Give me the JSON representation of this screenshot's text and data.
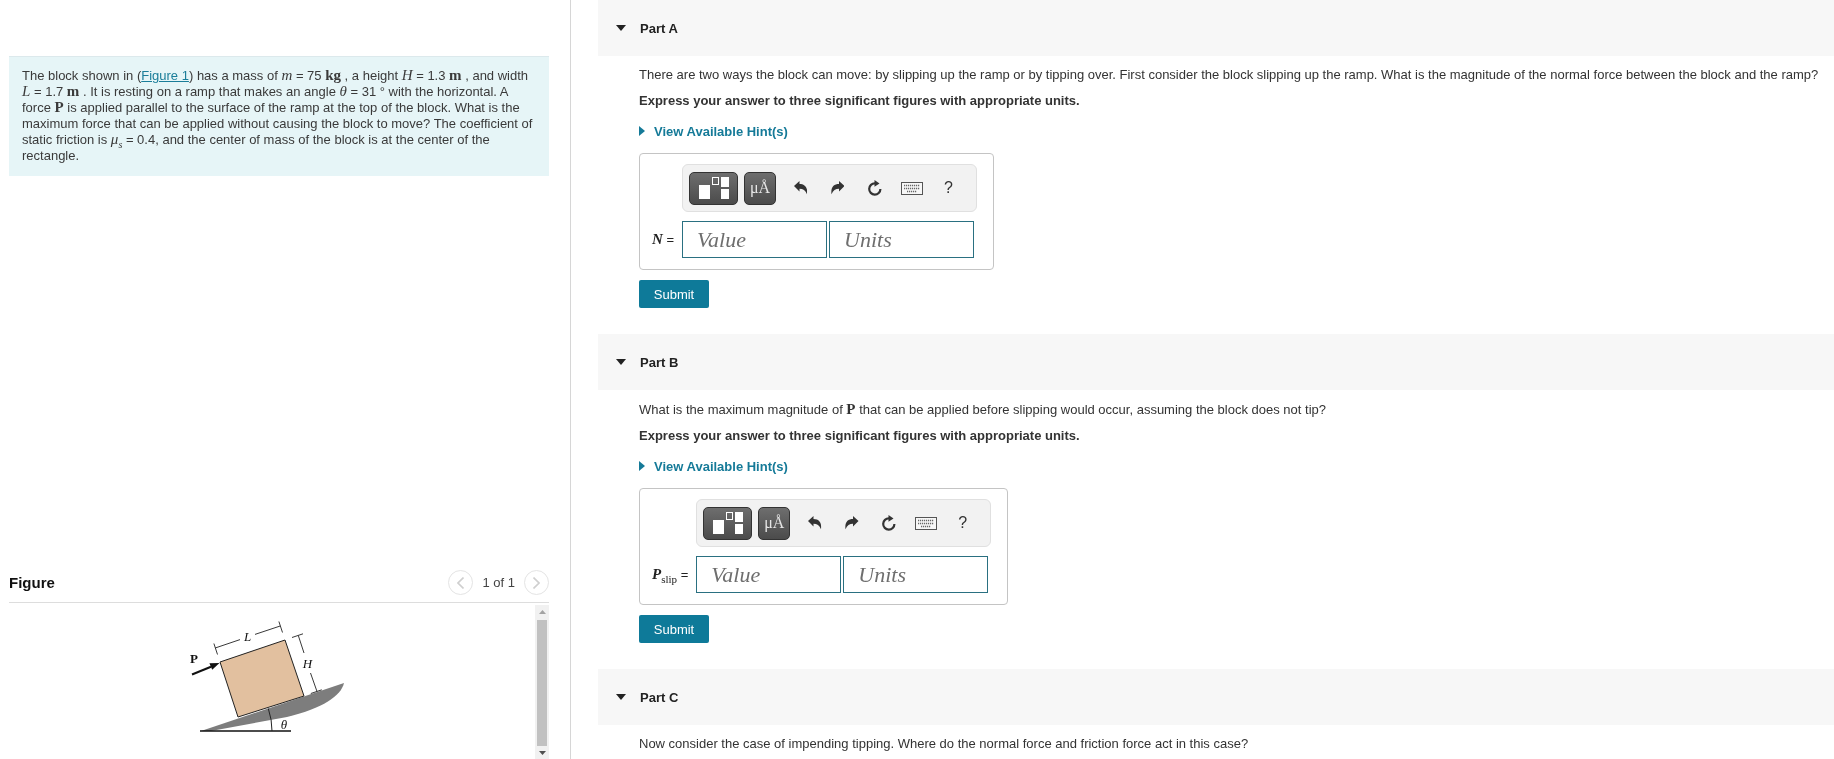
{
  "problem": {
    "text_before": "The block shown in (",
    "link": "Figure 1",
    "text_after": ") has a mass of *m* = 75 **kg** , a height *H* = 1.3 **m** , and width *L* = 1.7 **m** . It is resting on a ramp that makes an angle *θ* = 31 ° with the horizontal. A force **P** is applied parallel to the surface of the ramp at the top of the block. What is the maximum force that can be applied without causing the block to move? The coefficient of static friction is *μ*$_{s}$ = 0.4, and the center of mass of the block is at the center of the rectangle."
  },
  "figure": {
    "title": "Figure",
    "pager": {
      "label": "1 of 1",
      "previous_disabled": true,
      "next_disabled": true
    },
    "labels": {
      "force": "P",
      "length": "L",
      "height": "H",
      "angle": "θ"
    }
  },
  "parts": [
    {
      "title": "Part A",
      "expanded": true,
      "question": "There are two ways the block can move: by slipping up the ramp or by tipping over. First consider the block slipping up the ramp. What is the magnitude of the normal force between the block and the ramp?",
      "instruction": "Express your answer to three significant figures with appropriate units.",
      "hint": {
        "label": "View Available Hint(s)",
        "expanded": false
      },
      "toolbar": {
        "units_button": "μÅ",
        "help_button": "?"
      },
      "answer": {
        "label": "*N* =",
        "value_placeholder": "Value",
        "units_placeholder": "Units"
      },
      "submit": "Submit"
    },
    {
      "title": "Part B",
      "expanded": true,
      "question": "What is the maximum magnitude of **P** that can be applied before slipping would occur, assuming the block does not tip?",
      "instruction": "Express your answer to three significant figures with appropriate units.",
      "hint": {
        "label": "View Available Hint(s)",
        "expanded": false
      },
      "toolbar": {
        "units_button": "μÅ",
        "help_button": "?"
      },
      "answer": {
        "label": "*P*$_{slip}$ =",
        "value_placeholder": "Value",
        "units_placeholder": "Units"
      },
      "submit": "Submit"
    },
    {
      "title": "Part C",
      "expanded": true,
      "question": "Now consider the case of impending tipping. Where do the normal force and friction force act in this case?"
    }
  ]
}
